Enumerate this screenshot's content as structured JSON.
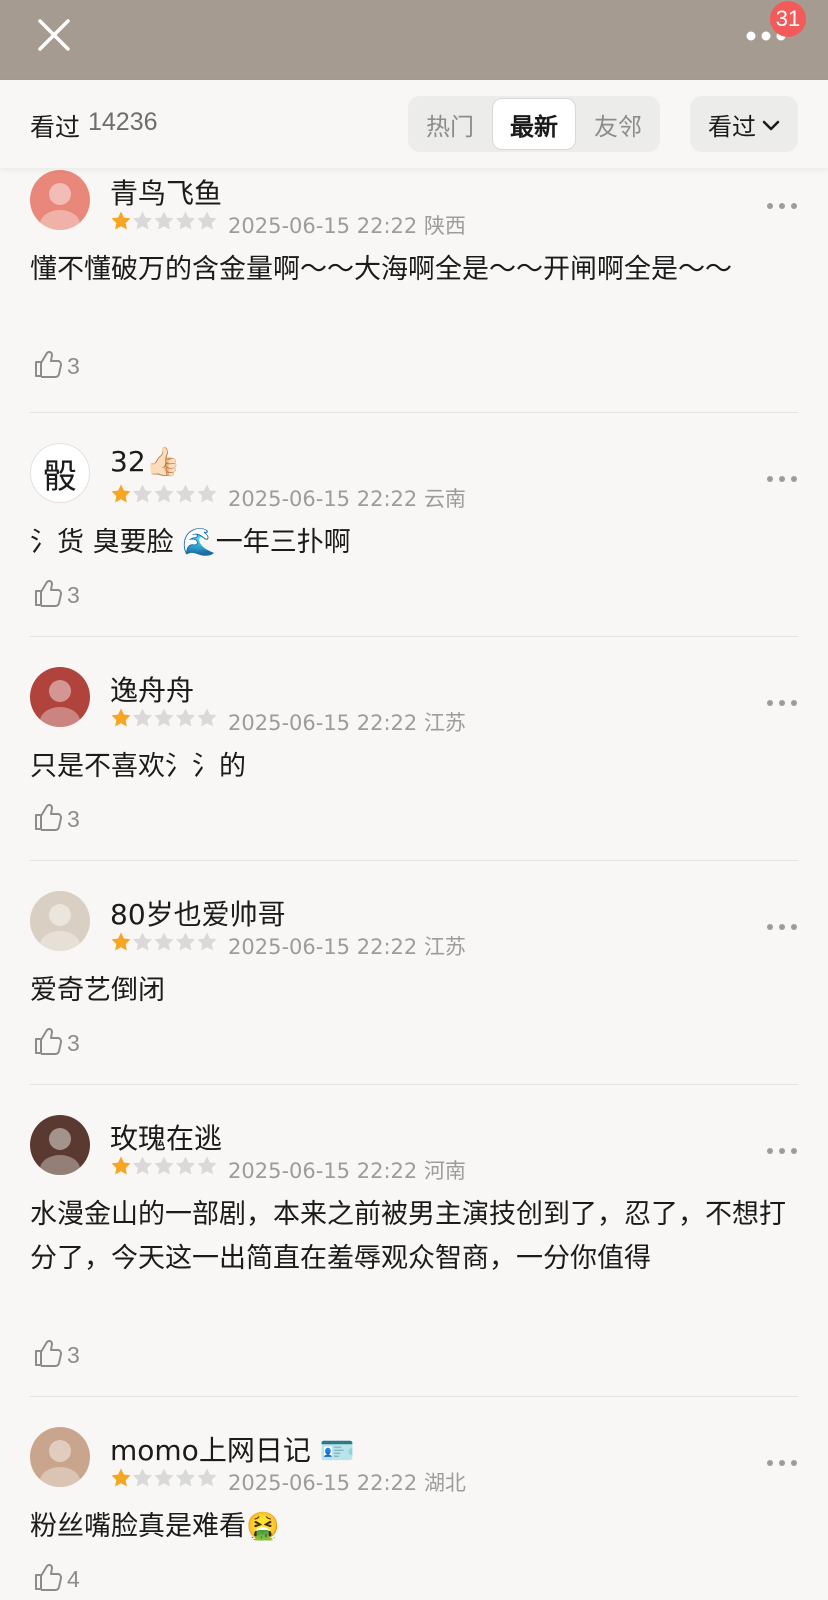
{
  "header": {
    "badge_count": "31"
  },
  "filter": {
    "seen_label": "看过",
    "seen_count": "14236",
    "tabs": [
      {
        "label": "热门",
        "active": false
      },
      {
        "label": "最新",
        "active": true
      },
      {
        "label": "友邻",
        "active": false
      }
    ],
    "dropdown_label": "看过"
  },
  "colors": {
    "topbar": "#a69b91",
    "star_on": "#f5a623",
    "star_off": "#d9d9d9",
    "badge": "#f35b5b"
  },
  "comments": [
    {
      "user": "青鸟飞鱼",
      "rating": 1,
      "datetime": "2025-06-15 22:22",
      "location": "陕西",
      "text": "懂不懂破万的含金量啊～～大海啊全是～～开闸啊全是～～",
      "likes": "3",
      "avatar_icon": "girl-cartoon-avatar",
      "avatar_color": "#e8877a"
    },
    {
      "user": "32👍🏻",
      "rating": 1,
      "datetime": "2025-06-15 22:22",
      "location": "云南",
      "text": "氵货 臭要脸 🌊一年三扑啊",
      "likes": "3",
      "avatar_icon": "calligraphy-avatar",
      "avatar_text": "骰",
      "avatar_color": "#ffffff"
    },
    {
      "user": "逸舟舟",
      "rating": 1,
      "datetime": "2025-06-15 22:22",
      "location": "江苏",
      "text": "只是不喜欢氵氵的",
      "likes": "3",
      "avatar_icon": "girl-photo-avatar",
      "avatar_color": "#b0433b"
    },
    {
      "user": "80岁也爱帅哥",
      "rating": 1,
      "datetime": "2025-06-15 22:22",
      "location": "江苏",
      "text": "爱奇艺倒闭",
      "likes": "3",
      "avatar_icon": "cat-avatar",
      "avatar_color": "#d9cfc2"
    },
    {
      "user": "玫瑰在逃",
      "rating": 1,
      "datetime": "2025-06-15 22:22",
      "location": "河南",
      "text": "水漫金山的一部剧，本来之前被男主演技创到了，忍了，不想打分了，今天这一出简直在羞辱观众智商，一分你值得",
      "likes": "3",
      "avatar_icon": "elder-photo-avatar",
      "avatar_color": "#5a3a30"
    },
    {
      "user": "momo上网日记 🪪",
      "rating": 1,
      "datetime": "2025-06-15 22:22",
      "location": "湖北",
      "text": "粉丝嘴脸真是难看🤮",
      "likes": "4",
      "avatar_icon": "woman-photo-avatar",
      "avatar_color": "#c9a58d"
    }
  ]
}
